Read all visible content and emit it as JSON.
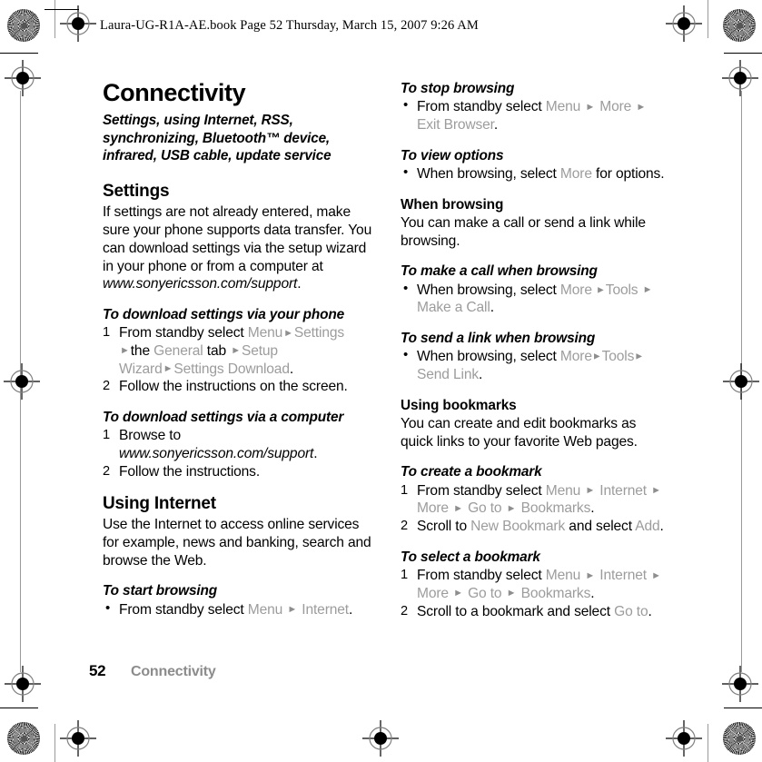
{
  "print_header": {
    "text": "Laura-UG-R1A-AE.book  Page 52  Thursday, March 15, 2007  9:26 AM"
  },
  "footer": {
    "page_number": "52",
    "chapter": "Connectivity"
  },
  "left_column": {
    "chapter_title": "Connectivity",
    "chapter_subtitle": "Settings, using Internet, RSS, synchronizing, Bluetooth™ device, infrared, USB cable, update service",
    "settings_heading": "Settings",
    "settings_body_1": "If settings are not already entered, make sure your phone supports data transfer. You can download settings via the setup wizard in your phone or from a computer at ",
    "settings_body_url": "www.sonyericsson.com/support",
    "settings_body_end": ".",
    "proc_download_phone": {
      "title": "To download settings via your phone",
      "step1_pre": "From standby select ",
      "step1_menu": "Menu",
      "step1_settings": "Settings",
      "step1_the": "the ",
      "step1_general": "General",
      "step1_tab": " tab ",
      "step1_wizard": "Setup Wizard",
      "step1_download": "Settings Download",
      "step1_end": ".",
      "step2": "Follow the instructions on the screen."
    },
    "proc_download_computer": {
      "title": "To download settings via a computer",
      "step1_pre": "Browse to ",
      "step1_url": "www.sonyericsson.com/support",
      "step1_end": ".",
      "step2": "Follow the instructions."
    },
    "internet_heading": "Using Internet",
    "internet_body": "Use the Internet to access online services for example, news and banking, search and browse the Web.",
    "proc_start_browsing": {
      "title": "To start browsing",
      "step1_pre": "From standby select ",
      "step1_menu": "Menu",
      "step1_internet": "Internet",
      "step1_end": "."
    }
  },
  "right_column": {
    "proc_stop_browsing": {
      "title": "To stop browsing",
      "step1_pre": "From standby select ",
      "step1_menu": "Menu",
      "step1_more": "More",
      "step1_exit": "Exit Browser",
      "step1_end": "."
    },
    "proc_view_options": {
      "title": "To view options",
      "step1_pre": "When browsing, select ",
      "step1_more": "More",
      "step1_post": " for options."
    },
    "when_browsing_heading": "When browsing",
    "when_browsing_body": "You can make a call or send a link while browsing.",
    "proc_make_call": {
      "title": "To make a call when browsing",
      "step1_pre": "When browsing, select ",
      "step1_more": "More",
      "step1_tools": "Tools",
      "step1_makecall": "Make a Call",
      "step1_end": "."
    },
    "proc_send_link": {
      "title": "To send a link when browsing",
      "step1_pre": "When browsing, select ",
      "step1_more": "More",
      "step1_tools": "Tools",
      "step1_sendlink": "Send Link",
      "step1_end": "."
    },
    "bookmarks_heading": "Using bookmarks",
    "bookmarks_body": "You can create and edit bookmarks as quick links to your favorite Web pages.",
    "proc_create_bookmark": {
      "title": "To create a bookmark",
      "step1_pre": "From standby select ",
      "step1_menu": "Menu",
      "step1_internet": "Internet",
      "step1_more": "More",
      "step1_goto": "Go to",
      "step1_bookmarks": "Bookmarks",
      "step1_end": ".",
      "step2_pre": "Scroll to ",
      "step2_newbookmark": "New Bookmark",
      "step2_mid": " and select ",
      "step2_add": "Add",
      "step2_end": "."
    },
    "proc_select_bookmark": {
      "title": "To select a bookmark",
      "step1_pre": "From standby select ",
      "step1_menu": "Menu",
      "step1_internet": "Internet",
      "step1_more": "More",
      "step1_goto": "Go to",
      "step1_bookmarks": "Bookmarks",
      "step1_end": ".",
      "step2_pre": "Scroll to a bookmark and select ",
      "step2_goto": "Go to",
      "step2_end": "."
    }
  },
  "marks": {
    "arrow_glyph": "►",
    "bullet_glyph": "•"
  },
  "colors": {
    "menu_text": "#9c9c9c",
    "footer_chapter": "#8c8c8c",
    "body_text": "#000000"
  }
}
